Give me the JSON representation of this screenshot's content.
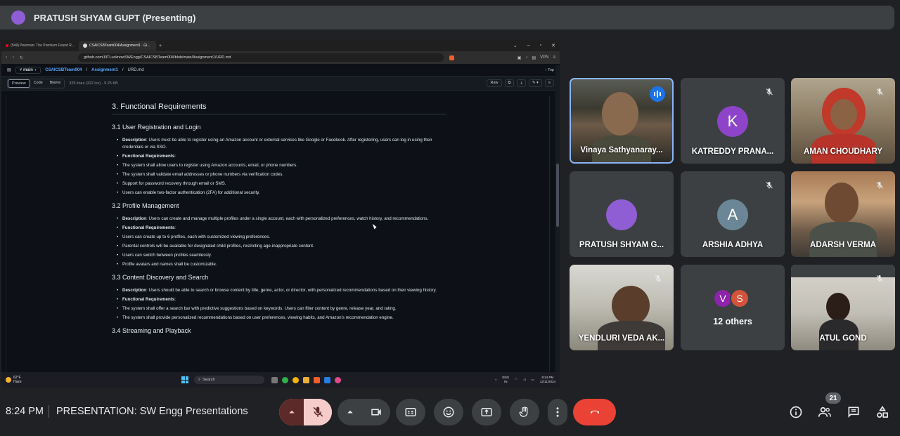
{
  "presenter": {
    "name": "PRATUSH SHYAM GUPT (Presenting)"
  },
  "screen": {
    "tabs": [
      {
        "label": "(549) Peerman: The Premium Found R..."
      },
      {
        "label": "CSAICSBTeam004/Assignment1 · Gi..."
      }
    ],
    "url": "github.com/IIITLucknowSWEngg/CSAICSBTeam004/blob/main/Assignment1/URD.md",
    "vpn_label": "VPN",
    "branch": "main",
    "breadcrumb": {
      "repo": "CSAICSBTeam004",
      "folder": "Assignment1",
      "file": "URD.md"
    },
    "top_label": "Top",
    "view_tabs": [
      "Preview",
      "Code",
      "Blame"
    ],
    "file_meta": "325 lines (322 loc) · 9.25 KB",
    "raw_label": "Raw",
    "doc": {
      "heading": "3. Functional Requirements",
      "sections": [
        {
          "title": "3.1 User Registration and Login",
          "desc_label": "Description",
          "desc": ": Users must be able to register using an Amazon account or external services like Google or Facebook. After registering, users can log in using their credentials or via SSO.",
          "fr_label": "Functional Requirements",
          "items": [
            "The system shall allow users to register using Amazon accounts, email, or phone numbers.",
            "The system shall validate email addresses or phone numbers via verification codes.",
            "Support for password recovery through email or SMS.",
            "Users can enable two-factor authentication (2FA) for additional security."
          ]
        },
        {
          "title": "3.2 Profile Management",
          "desc_label": "Description",
          "desc": ": Users can create and manage multiple profiles under a single account, each with personalized preferences, watch history, and recommendations.",
          "fr_label": "Functional Requirements",
          "items": [
            "Users can create up to 6 profiles, each with customized viewing preferences.",
            "Parental controls will be available for designated child profiles, restricting age-inappropriate content.",
            "Users can switch between profiles seamlessly.",
            "Profile avatars and names shall be customizable."
          ]
        },
        {
          "title": "3.3 Content Discovery and Search",
          "desc_label": "Description",
          "desc": ": Users should be able to search or browse content by title, genre, actor, or director, with personalized recommendations based on their viewing history.",
          "fr_label": "Functional Requirements",
          "items": [
            "The system shall offer a search bar with predictive suggestions based on keywords. Users can filter content by genre, release year, and rating.",
            "The system shall provide personalized recommendations based on user preferences, viewing habits, and Amazon's recommendation engine."
          ]
        }
      ],
      "cut_heading": "3.4 Streaming and Playback"
    },
    "taskbar": {
      "temp": "62°F",
      "weather": "Haze",
      "search": "Search",
      "lang": "ENG",
      "lang2": "IN",
      "time": "8:24 PM",
      "date": "12/11/2024"
    }
  },
  "participants": [
    {
      "name": "Vinaya Sathyanaray...",
      "speaking": true
    },
    {
      "name": "KATREDDY PRANA...",
      "initial": "K",
      "avatar_color": "#8e44c9"
    },
    {
      "name": "AMAN CHOUDHARY"
    },
    {
      "name": "PRATUSH SHYAM G...",
      "avatar_color": "#8f5ed4"
    },
    {
      "name": "ARSHIA ADHYA",
      "initial": "A",
      "avatar_color": "#6b8797"
    },
    {
      "name": "ADARSH VERMA"
    },
    {
      "name": "YENDLURI VEDA AK..."
    },
    {
      "name": "12 others",
      "initials": [
        "V",
        "S"
      ],
      "colors": [
        "#8e24aa",
        "#d3533c"
      ]
    },
    {
      "name": "ATUL GOND"
    }
  ],
  "meeting": {
    "time": "8:24 PM",
    "title": "PRESENTATION: SW Engg Presentations",
    "people_count": "21"
  },
  "colors": {
    "end_call": "#ea4335",
    "mic_muted_bg": "#f6ccca",
    "speaking_blue": "#1a73e8"
  }
}
